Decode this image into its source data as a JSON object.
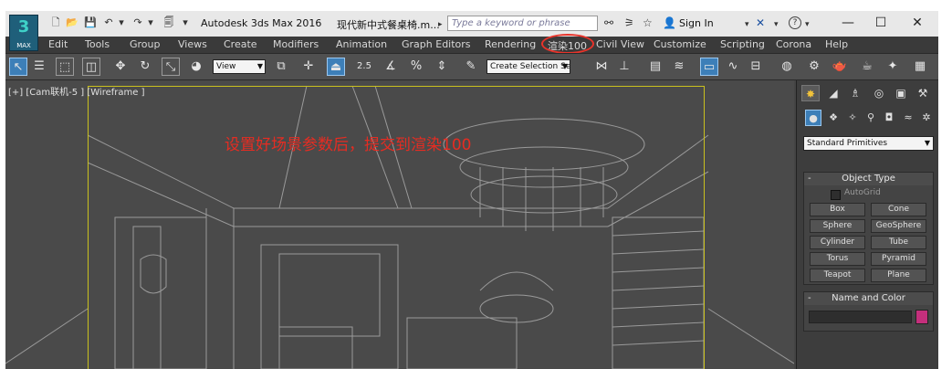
{
  "titlebar": {
    "app_logo_label": "MAX",
    "app_title": "Autodesk 3ds Max 2016",
    "document_title": "现代新中式餐桌椅.m...",
    "search_placeholder": "Type a keyword or phrase",
    "sign_in": "Sign In"
  },
  "menu": {
    "items": [
      "Edit",
      "Tools",
      "Group",
      "Views",
      "Create",
      "Modifiers",
      "Animation",
      "Graph Editors",
      "Rendering",
      "渲染100",
      "Civil View",
      "Customize",
      "Scripting",
      "Corona",
      "Help"
    ],
    "highlighted_index": 9
  },
  "toolbar": {
    "reference_coordinate": "View",
    "snap_label": "2.5",
    "percent_snap": "%",
    "named_selection_placeholder": "Create Selection Se"
  },
  "viewport": {
    "label": "[+] [Cam联机-5 ] [Wireframe ]",
    "annotation": "设置好场景参数后，提交到渲染100"
  },
  "command_panel": {
    "category": "Standard Primitives",
    "object_type": {
      "title": "Object Type",
      "autogrid": "AutoGrid",
      "buttons": [
        "Box",
        "Cone",
        "Sphere",
        "GeoSphere",
        "Cylinder",
        "Tube",
        "Torus",
        "Pyramid",
        "Teapot",
        "Plane"
      ]
    },
    "name_and_color": {
      "title": "Name and Color",
      "swatch_color": "#c42f7c"
    }
  },
  "colors": {
    "highlight_red": "#e8332a",
    "viewport_frame": "#c9c01e",
    "active_blue": "#3d7fb8"
  }
}
